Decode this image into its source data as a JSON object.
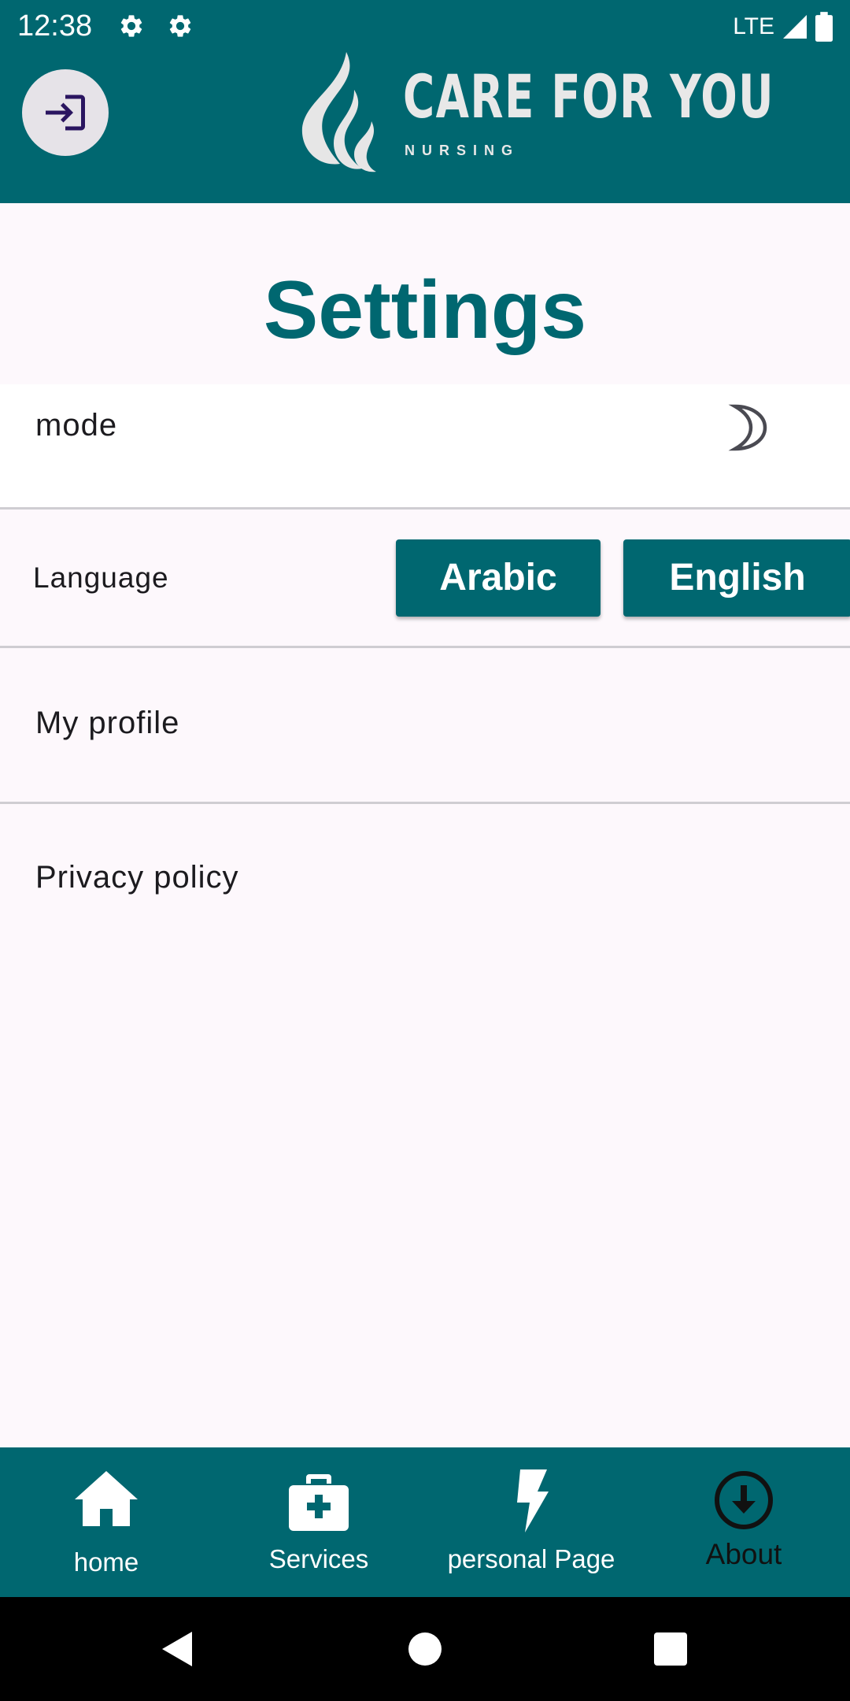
{
  "status_bar": {
    "time": "12:38",
    "network": "LTE",
    "icons": [
      "gear-icon",
      "gear-icon",
      "signal-icon",
      "battery-icon"
    ]
  },
  "header": {
    "login_icon": "login-icon",
    "logo_title": "CARE FOR YOU",
    "logo_subtitle": "NURSING"
  },
  "page": {
    "title": "Settings"
  },
  "settings": {
    "mode_label": "mode",
    "mode_icon": "moon-icon",
    "language_label": "Language",
    "language_options": [
      "Arabic",
      "English"
    ],
    "profile_label": "My profile",
    "privacy_label": "Privacy policy"
  },
  "bottom_nav": {
    "items": [
      {
        "label": "home",
        "icon": "home-icon"
      },
      {
        "label": "Services",
        "icon": "medical-kit-icon"
      },
      {
        "label": "personal Page",
        "icon": "lightning-icon"
      },
      {
        "label": "About",
        "icon": "download-circle-icon"
      }
    ]
  },
  "system_nav": [
    "back-icon",
    "home-circle-icon",
    "recents-icon"
  ],
  "colors": {
    "primary": "#006770",
    "background": "#fdf8fc",
    "divider": "#cfcdd2",
    "text": "#1c1b1f"
  }
}
